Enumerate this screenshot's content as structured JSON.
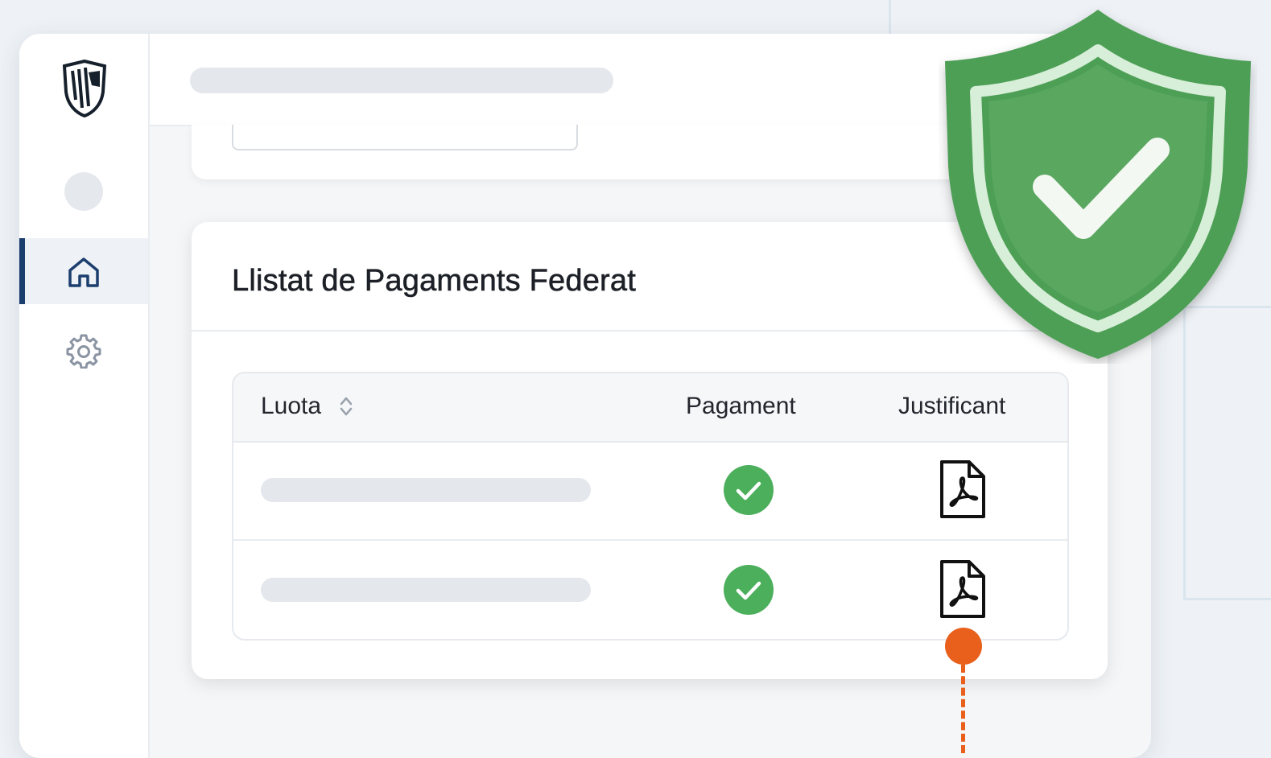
{
  "sidebar": {
    "items": [
      {
        "icon": "home-icon",
        "active": true
      },
      {
        "icon": "gear-icon",
        "active": false
      }
    ]
  },
  "panel": {
    "title": "Llistat de Pagaments Federat"
  },
  "table": {
    "columns": [
      "Luota",
      "Pagament",
      "Justificant"
    ],
    "rows": [
      {
        "pagament": "check-icon",
        "justificant": "pdf-file-icon"
      },
      {
        "pagament": "check-icon",
        "justificant": "pdf-file-icon"
      }
    ]
  },
  "colors": {
    "accent": "#1c3e6e",
    "success": "#4caf5c",
    "shield": "#4e9f56",
    "connector": "#e8601c"
  }
}
